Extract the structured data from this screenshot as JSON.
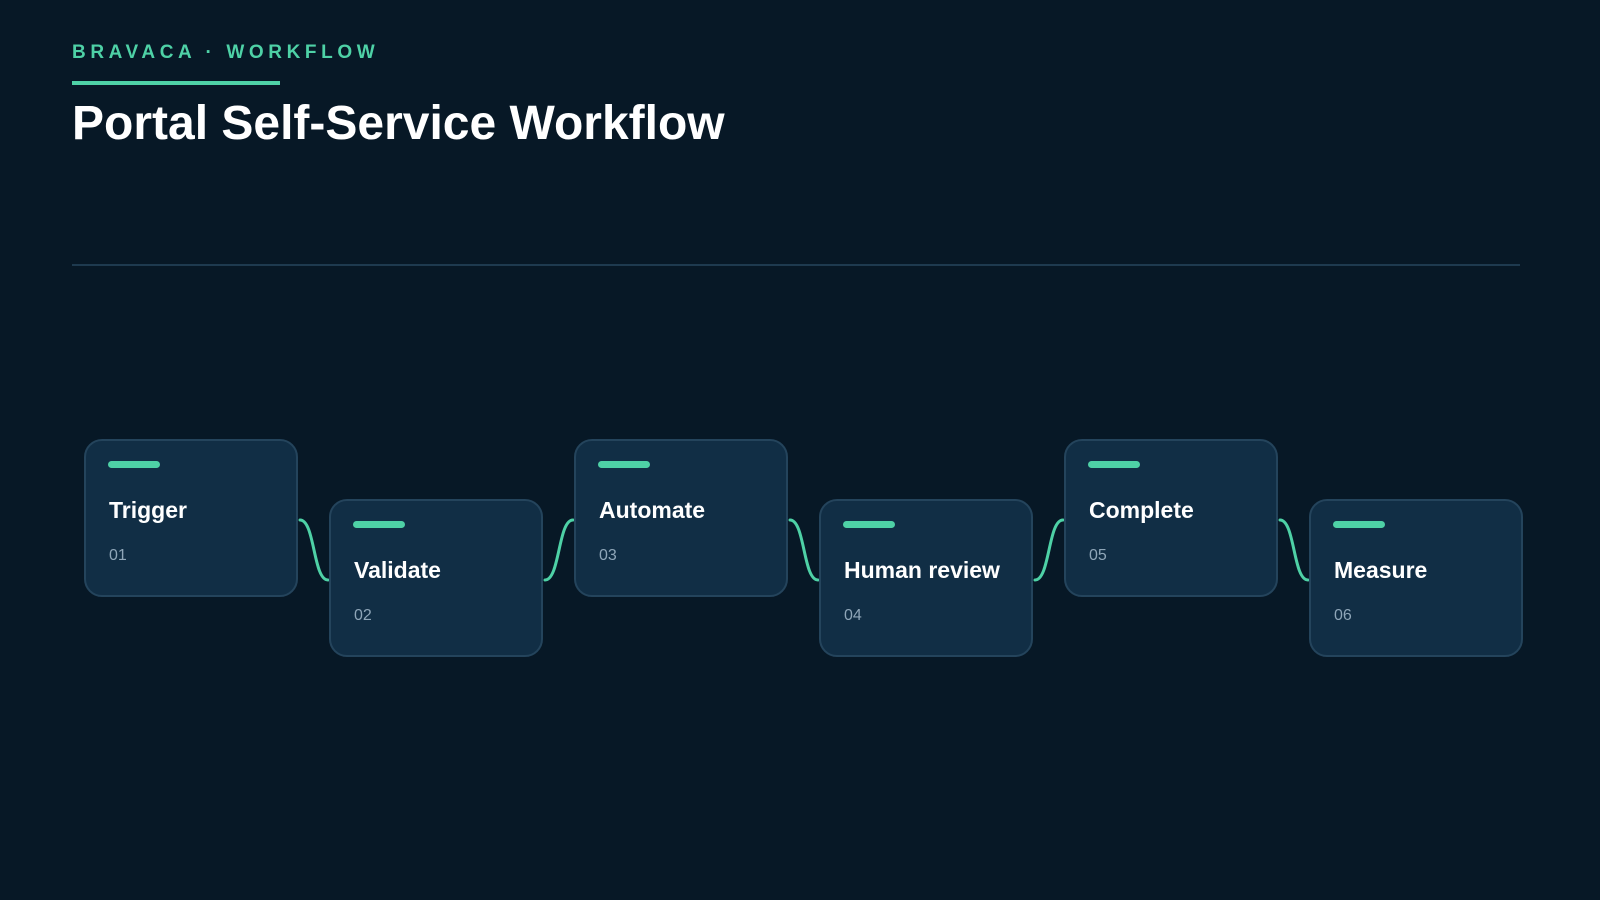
{
  "header": {
    "eyebrow": "BRAVACA · WORKFLOW",
    "title": "Portal Self-Service Workflow"
  },
  "colors": {
    "background": "#071826",
    "accent": "#4ed1a6",
    "card": "#112e45",
    "card_border": "#24445c",
    "muted_text": "#8fa6b8"
  },
  "steps": [
    {
      "label": "Trigger",
      "number": "01"
    },
    {
      "label": "Validate",
      "number": "02"
    },
    {
      "label": "Automate",
      "number": "03"
    },
    {
      "label": "Human review",
      "number": "04"
    },
    {
      "label": "Complete",
      "number": "05"
    },
    {
      "label": "Measure",
      "number": "06"
    }
  ]
}
